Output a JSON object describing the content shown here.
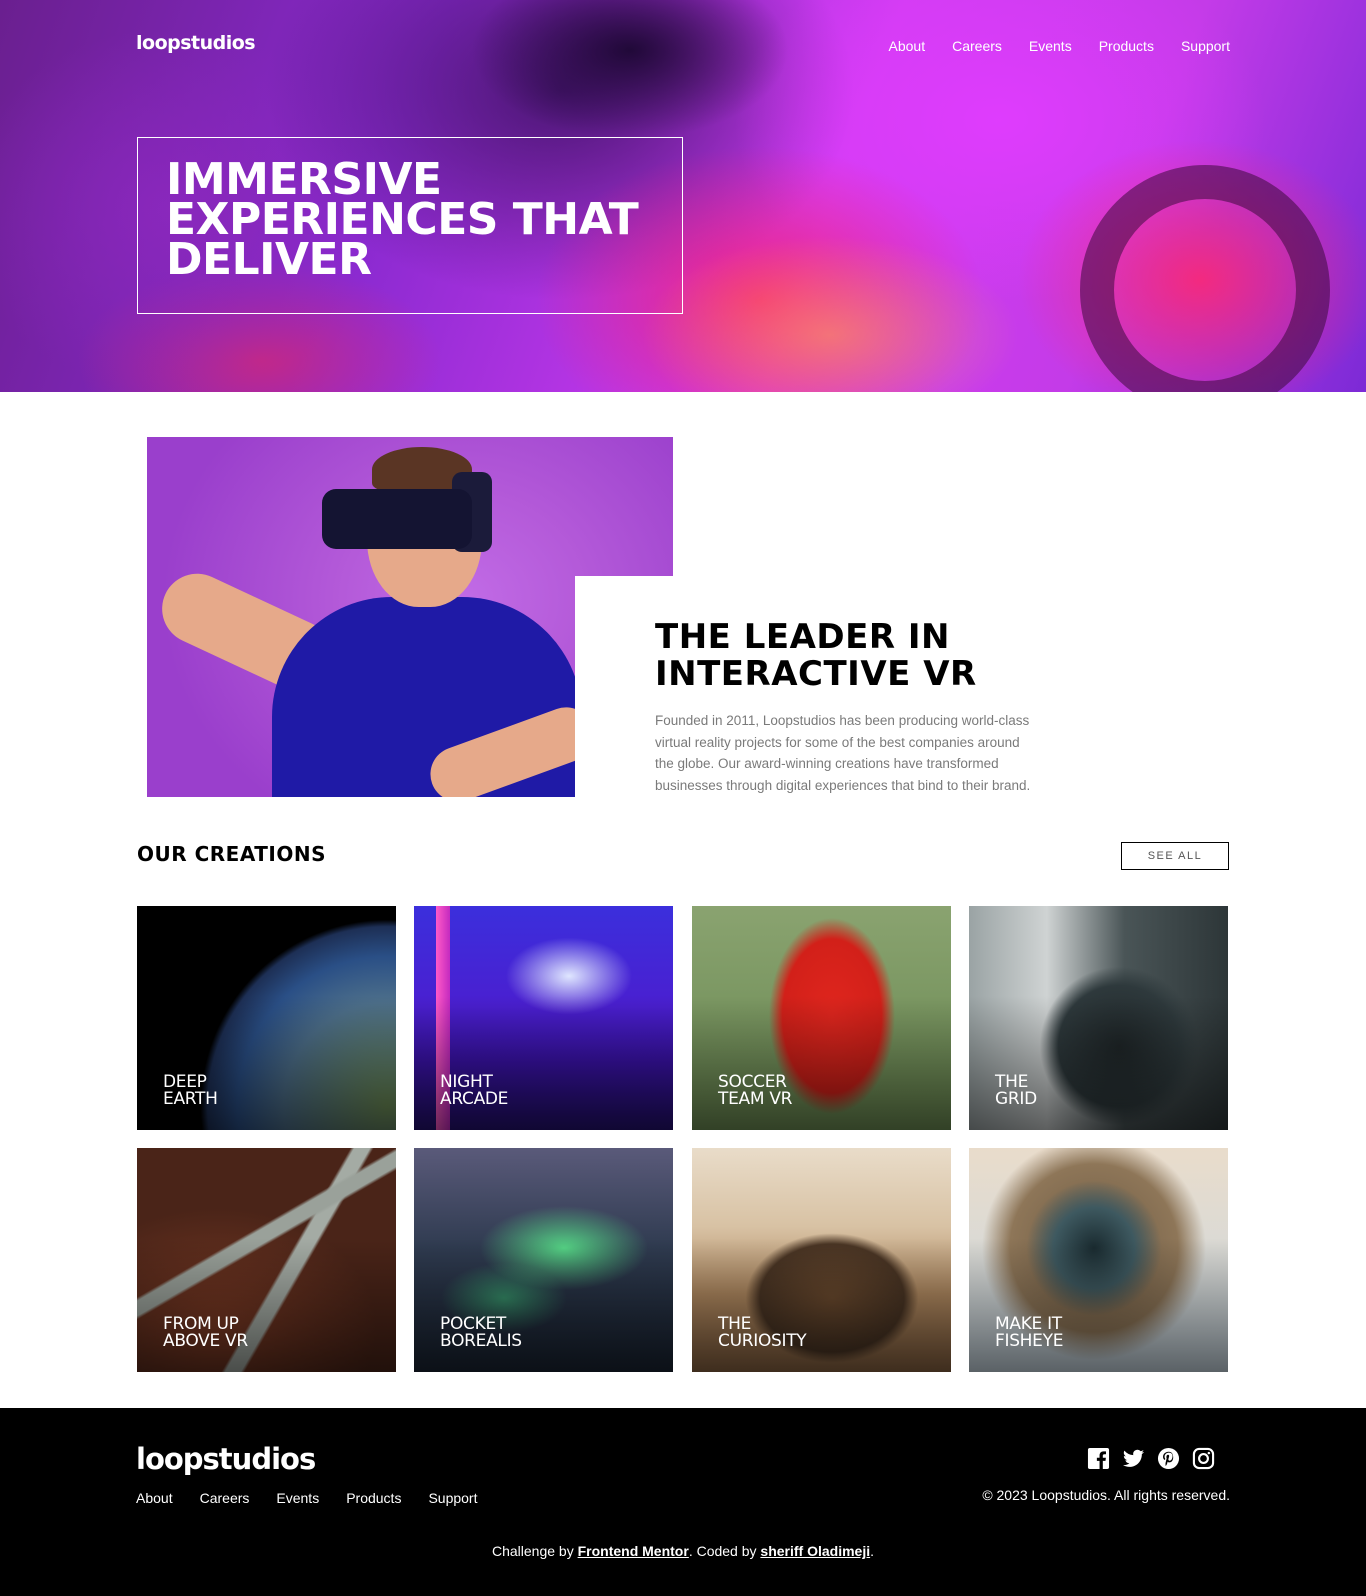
{
  "header": {
    "logo": "loopstudios",
    "nav": [
      "About",
      "Careers",
      "Events",
      "Products",
      "Support"
    ]
  },
  "hero": {
    "title": "IMMERSIVE\nEXPERIENCES THAT\nDELIVER"
  },
  "intro": {
    "heading": "THE LEADER IN\nINTERACTIVE VR",
    "text": "Founded in 2011, Loopstudios has been producing world-class virtual reality projects for some of the best companies around the globe. Our award-winning creations have transformed businesses through digital experiences that bind to their brand."
  },
  "creations": {
    "title": "OUR CREATIONS",
    "see_all": "SEE ALL",
    "items": [
      {
        "label": "DEEP\nEARTH"
      },
      {
        "label": "NIGHT\nARCADE"
      },
      {
        "label": "SOCCER\nTEAM VR"
      },
      {
        "label": "THE\nGRID"
      },
      {
        "label": "FROM UP\nABOVE VR"
      },
      {
        "label": "POCKET\nBOREALIS"
      },
      {
        "label": "THE\nCURIOSITY"
      },
      {
        "label": "MAKE IT\nFISHEYE"
      }
    ]
  },
  "footer": {
    "logo": "loopstudios",
    "nav": [
      "About",
      "Careers",
      "Events",
      "Products",
      "Support"
    ],
    "social_icons": [
      "facebook-icon",
      "twitter-icon",
      "pinterest-icon",
      "instagram-icon"
    ],
    "copyright": "© 2023 Loopstudios. All rights reserved.",
    "attribution": {
      "prefix": "Challenge by ",
      "mentor": "Frontend Mentor",
      "middle": ". Coded by ",
      "author": "sheriff Oladimeji",
      "suffix": "."
    }
  }
}
